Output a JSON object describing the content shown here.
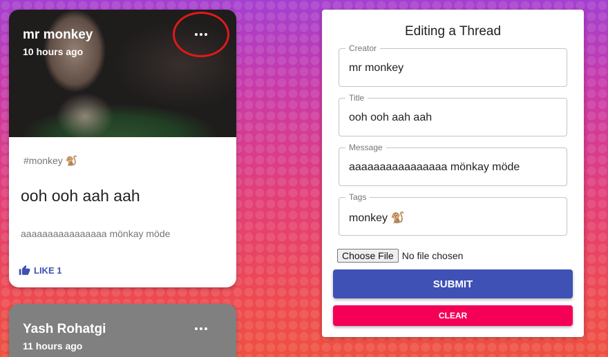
{
  "posts": [
    {
      "author": "mr monkey",
      "time": "10 hours ago",
      "tags": "#monkey 🐒",
      "title": "ooh ooh aah aah",
      "message": "aaaaaaaaaaaaaaaa mönkay möde",
      "like_label": "LIKE 1",
      "more_icon": "more-horiz-icon",
      "like_icon": "thumb-up-icon"
    },
    {
      "author": "Yash Rohatgi",
      "time": "11 hours ago",
      "more_icon": "more-horiz-icon"
    }
  ],
  "form": {
    "heading": "Editing a Thread",
    "creator": {
      "label": "Creator",
      "value": "mr monkey"
    },
    "title": {
      "label": "Title",
      "value": "ooh ooh aah aah"
    },
    "message": {
      "label": "Message",
      "value": "aaaaaaaaaaaaaaaa mönkay möde"
    },
    "tags": {
      "label": "Tags",
      "value": "monkey 🐒"
    },
    "file_button": "Choose File",
    "file_status": "No file chosen",
    "submit_label": "SUBMIT",
    "clear_label": "CLEAR"
  },
  "colors": {
    "primary": "#3f51b5",
    "secondary": "#f50057",
    "highlight_circle": "#e0191b"
  }
}
